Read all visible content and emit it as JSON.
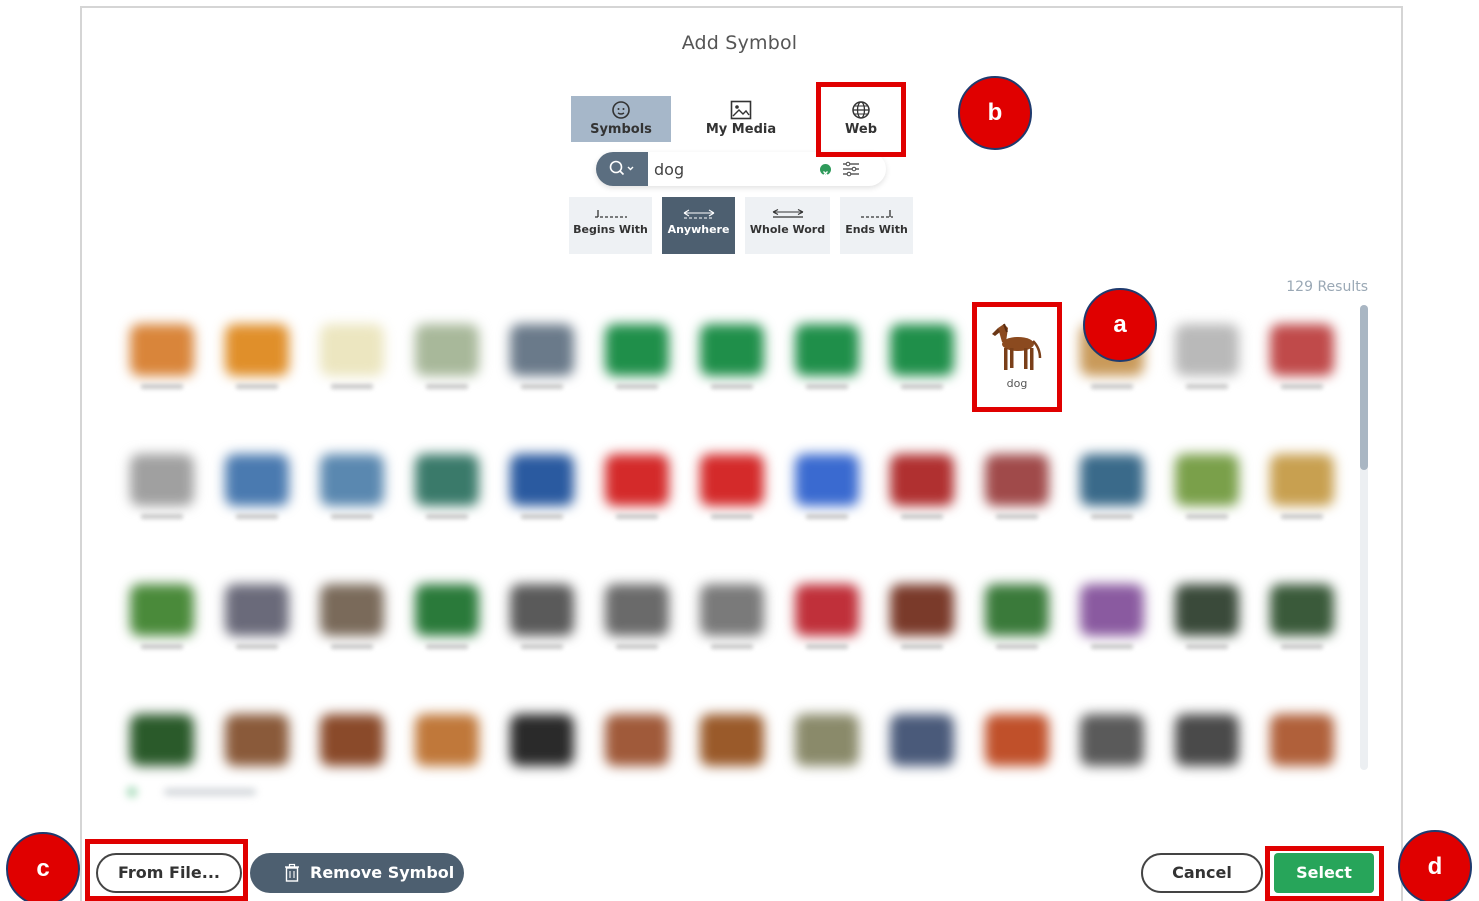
{
  "dialog": {
    "title": "Add Symbol"
  },
  "tabs": [
    {
      "label": "Symbols",
      "icon": "face-icon",
      "active": true
    },
    {
      "label": "My Media",
      "icon": "image-icon",
      "active": false
    },
    {
      "label": "Web",
      "icon": "globe-icon",
      "active": false
    }
  ],
  "search": {
    "value": "dog",
    "icon": "search-icon"
  },
  "match_modes": [
    {
      "label": "Begins With",
      "active": false
    },
    {
      "label": "Anywhere",
      "active": true
    },
    {
      "label": "Whole Word",
      "active": false
    },
    {
      "label": "Ends With",
      "active": false
    }
  ],
  "results": {
    "count_text": "129 Results",
    "selected_caption": "dog"
  },
  "footer": {
    "from_file": "From File...",
    "remove_symbol": "Remove Symbol",
    "cancel": "Cancel",
    "select": "Select"
  },
  "annotations": [
    "a",
    "b",
    "c",
    "d"
  ],
  "colors": {
    "tab_active": "#a6b7c9",
    "mode_active": "#4d5f70",
    "select_green": "#27a55a",
    "highlight_red": "#e00000"
  }
}
